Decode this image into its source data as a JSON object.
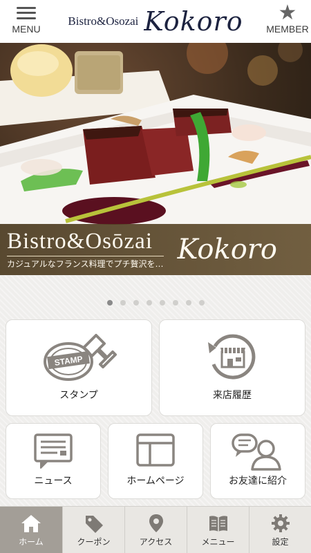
{
  "header": {
    "menu_label": "MENU",
    "member_label": "MEMBER",
    "logo_small": "Bistro&Osozai",
    "logo_script": "Kokoro"
  },
  "hero": {
    "banner_title": "Bistro&Osōzai",
    "banner_tagline": "カジュアルなフランス料理でプチ贅沢を…",
    "banner_script": "Kokoro"
  },
  "carousel": {
    "dot_count": 8,
    "active_index": 0
  },
  "tiles": {
    "stamp": "スタンプ",
    "history": "来店履歴",
    "news": "ニュース",
    "homepage": "ホームページ",
    "friend": "お友達に紹介",
    "stamp_icon_text": "STAMP"
  },
  "nav": [
    {
      "label": "ホーム",
      "icon": "home-icon"
    },
    {
      "label": "クーポン",
      "icon": "coupon-tag-icon"
    },
    {
      "label": "アクセス",
      "icon": "map-pin-icon"
    },
    {
      "label": "メニュー",
      "icon": "book-icon"
    },
    {
      "label": "設定",
      "icon": "gear-icon"
    }
  ],
  "colors": {
    "brand_navy": "#1d2340",
    "banner_brown": "#4b3a20",
    "icon_gray": "#8a8580",
    "nav_active": "#a39e97"
  }
}
